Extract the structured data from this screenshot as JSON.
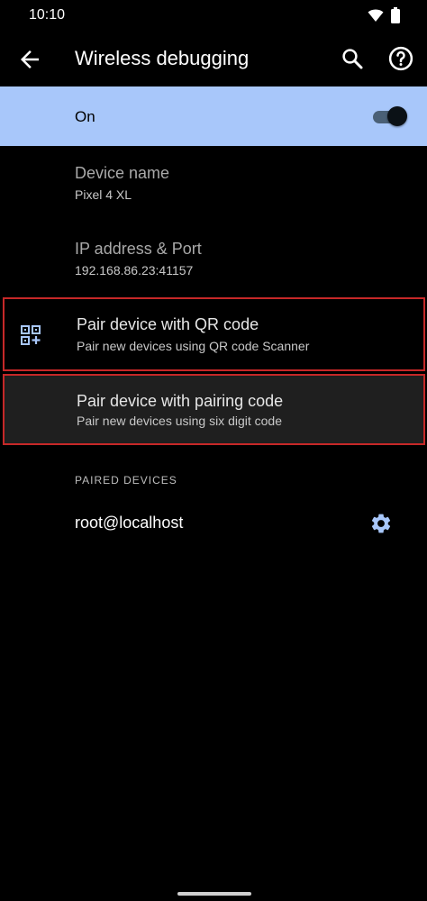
{
  "status_bar": {
    "time": "10:10",
    "icons": [
      "wifi-icon",
      "battery-icon"
    ]
  },
  "app_bar": {
    "title": "Wireless debugging",
    "back_icon": "arrow-back-icon",
    "search_icon": "search-icon",
    "help_icon": "help-icon"
  },
  "master_switch": {
    "label": "On",
    "checked": true,
    "background": "#a8c7fa"
  },
  "device_name": {
    "title": "Device name",
    "value": "Pixel 4 XL"
  },
  "ip_address": {
    "title": "IP address & Port",
    "value": "192.168.86.23:41157"
  },
  "pair_qr": {
    "title": "Pair device with QR code",
    "summary": "Pair new devices using QR code Scanner",
    "icon": "qr-code-add-icon"
  },
  "pair_code": {
    "title": "Pair device with pairing code",
    "summary": "Pair new devices using six digit code"
  },
  "paired_devices": {
    "header": "PAIRED DEVICES",
    "items": [
      {
        "name": "root@localhost",
        "icon": "settings-gear-icon"
      }
    ]
  },
  "colors": {
    "accent": "#a8c7fa",
    "highlight_border": "#c62828",
    "highlight_fill": "#1f1f1f"
  }
}
